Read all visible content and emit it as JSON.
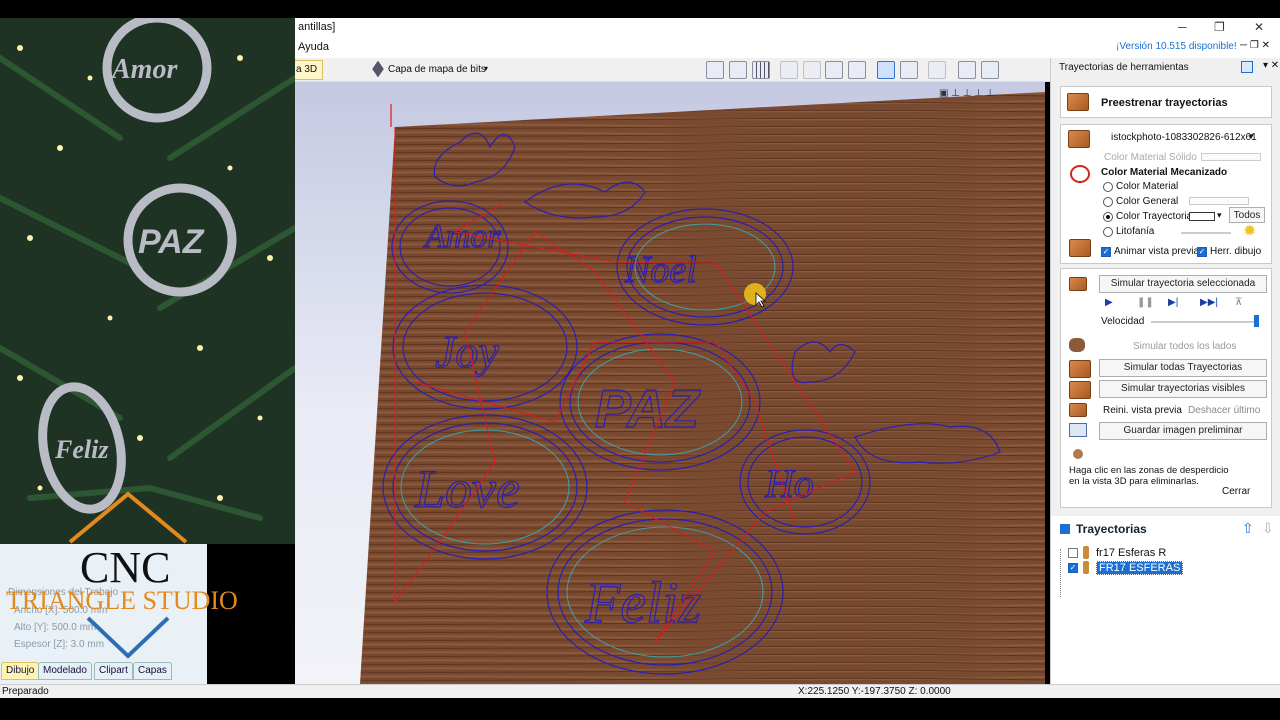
{
  "window": {
    "title_fragment": "antillas]",
    "update_notice": "¡Versión 10.515 disponible!",
    "minimize_glyph": "─",
    "maximize_glyph": "❐",
    "close_glyph": "✕"
  },
  "menu": {
    "help": "Ayuda"
  },
  "toolbar": {
    "view3d_tab": "a 3D",
    "bitmap_layer": "Capa de mapa de bits"
  },
  "overlay": {
    "brand_line1": "CNC",
    "brand_line2": "TRIANGLE STUDIO",
    "job_header": "Dimensiones del Trabajo",
    "width_row": "Ancho [X]: 500.0 mm",
    "height_row": "Alto [Y]: 500.0 mm",
    "thickness_row": "Espesor [Z]: 3.0 mm",
    "ornament_texts": [
      "Amor",
      "PAZ",
      "Feliz"
    ]
  },
  "bottom_tabs": [
    "Dibujo",
    "Modelado",
    "Clipart",
    "Capas"
  ],
  "status": {
    "ready": "Preparado",
    "coords": "X:225.1250 Y:-197.3750 Z: 0.0000"
  },
  "toolpaths_panel": {
    "header": "Trayectorias de herramientas",
    "preview_title": "Preestrenar trayectorias",
    "material_file": "istockphoto-1083302826-612x61",
    "solid_material_color": "Color Material Sólido",
    "machined_material_color": "Color Material Mecanizado",
    "radio_material": "Color Material",
    "radio_general": "Color General",
    "radio_toolpath": "Color Trayectoria",
    "radio_lithophane": "Litofanía",
    "all_button": "Todos",
    "animate_preview": "Animar vista previa",
    "drawing_tools": "Herr. dibujo",
    "simulate_selected": "Simular trayectoria seleccionada",
    "speed": "Velocidad",
    "simulate_all_sides": "Simular todos los lados",
    "simulate_all": "Simular todas Trayectorias",
    "simulate_visible": "Simular trayectorias visibles",
    "reset_preview": "Reini. vista previa",
    "undo_last": "Deshacer último",
    "save_preview_image": "Guardar imagen preliminar",
    "waste_hint_1": "Haga clic en las zonas de desperdicio",
    "waste_hint_2": "en la vista 3D para eliminarlas.",
    "close_button": "Cerrar",
    "speed_fraction": 1.0
  },
  "toolpaths_list": {
    "header": "Trayectorias",
    "items": [
      {
        "name": "fr17 Esferas R",
        "checked": false,
        "selected": false
      },
      {
        "name": "FR17 ESFERAS",
        "checked": true,
        "selected": true
      }
    ]
  },
  "colors": {
    "accent_blue": "#1a6fd4",
    "toolpath_blue": "#2a1fb0",
    "rapid_red": "#e3161c",
    "wood": "#7a4a30",
    "brand_orange": "#e28a1e",
    "brand_blue": "#2f6db5"
  }
}
